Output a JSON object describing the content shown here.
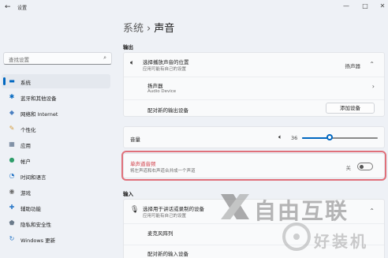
{
  "window": {
    "back": "←",
    "app_title": "设置",
    "minimize": "—",
    "maximize": "□",
    "close": "✕"
  },
  "sidebar": {
    "search_placeholder": "查找设置",
    "items": [
      {
        "label": "系统",
        "icon": "system-icon",
        "glyph": "▬",
        "color": "#0067c0"
      },
      {
        "label": "蓝牙和其他设备",
        "icon": "bluetooth-icon",
        "glyph": "✱",
        "color": "#0067c0"
      },
      {
        "label": "网络和 Internet",
        "icon": "network-icon",
        "glyph": "◆",
        "color": "#4a7fc1"
      },
      {
        "label": "个性化",
        "icon": "brush-icon",
        "glyph": "✎",
        "color": "#d49a3a"
      },
      {
        "label": "应用",
        "icon": "apps-icon",
        "glyph": "▦",
        "color": "#5a6f8a"
      },
      {
        "label": "帐户",
        "icon": "account-icon",
        "glyph": "●",
        "color": "#2e9d6a"
      },
      {
        "label": "时间和语言",
        "icon": "time-language-icon",
        "glyph": "◔",
        "color": "#2a78c8"
      },
      {
        "label": "游戏",
        "icon": "gaming-icon",
        "glyph": "◉",
        "color": "#6a6a6a"
      },
      {
        "label": "辅助功能",
        "icon": "accessibility-icon",
        "glyph": "✚",
        "color": "#2a78c8"
      },
      {
        "label": "隐私和安全性",
        "icon": "shield-icon",
        "glyph": "⬟",
        "color": "#6a7a8a"
      },
      {
        "label": "Windows 更新",
        "icon": "windows-update-icon",
        "glyph": "↻",
        "color": "#2a78c8"
      }
    ]
  },
  "main": {
    "breadcrumb_parent": "系统",
    "breadcrumb_sep": "›",
    "breadcrumb_current": "声音",
    "output_heading": "输出",
    "output": {
      "choose_title": "选择播放声音的位置",
      "choose_sub": "应用可能有自己的设置",
      "choose_value": "扬声器",
      "speaker_title": "扬声器",
      "speaker_sub": "Audio Device",
      "pair_title": "配对新的输出设备",
      "add_device": "添加设备"
    },
    "volume": {
      "label": "音量",
      "value": "36",
      "level": 0.36
    },
    "mono": {
      "title": "单声道音频",
      "sub": "将左声道和右声道合并成一个声道",
      "state": "关",
      "on": false
    },
    "input_heading": "输入",
    "input": {
      "choose_title": "选择用于讲话或录制的设备",
      "choose_sub": "应用可能有自己的设置",
      "mic_title": "麦克风阵列",
      "pair_title": "配对新的输入设备"
    },
    "colors": {
      "accent": "#0067c0",
      "highlight": "#e0707a"
    }
  },
  "watermark": {
    "brand": "自由互联",
    "brand2": "好装机"
  }
}
